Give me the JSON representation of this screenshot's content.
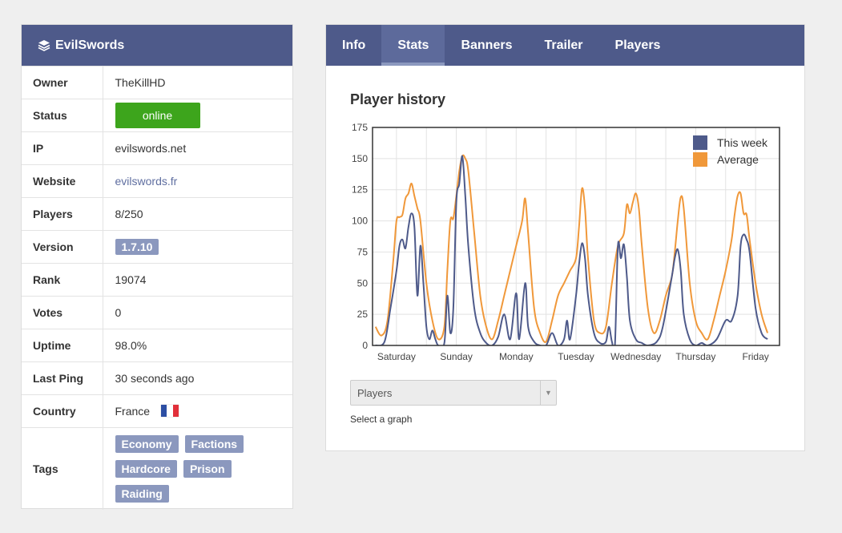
{
  "server": {
    "name": "EvilSwords",
    "icon": "layers-icon",
    "rows": {
      "owner": {
        "label": "Owner",
        "value": "TheKillHD"
      },
      "status": {
        "label": "Status",
        "value": "online",
        "color": "#3da51c"
      },
      "ip": {
        "label": "IP",
        "value": "evilswords.net"
      },
      "website": {
        "label": "Website",
        "value": "evilswords.fr"
      },
      "players": {
        "label": "Players",
        "value": "8/250"
      },
      "version": {
        "label": "Version",
        "value": "1.7.10"
      },
      "rank": {
        "label": "Rank",
        "value": "19074"
      },
      "votes": {
        "label": "Votes",
        "value": "0"
      },
      "uptime": {
        "label": "Uptime",
        "value": "98.0%"
      },
      "last_ping": {
        "label": "Last Ping",
        "value": "30 seconds ago"
      },
      "country": {
        "label": "Country",
        "value": "France",
        "icon": "flag-france-icon"
      },
      "tags": {
        "label": "Tags",
        "items": [
          "Economy",
          "Factions",
          "Hardcore",
          "Prison",
          "Raiding"
        ]
      }
    }
  },
  "tabs": [
    {
      "label": "Info",
      "active": false
    },
    {
      "label": "Stats",
      "active": true
    },
    {
      "label": "Banners",
      "active": false
    },
    {
      "label": "Trailer",
      "active": false
    },
    {
      "label": "Players",
      "active": false
    }
  ],
  "chart": {
    "title": "Player history",
    "select_value": "Players",
    "select_hint": "Select a graph"
  },
  "colors": {
    "header": "#4e5a8a",
    "this_week": "#4e5a8a",
    "average": "#f0983a",
    "tag": "#8b98be"
  },
  "chart_data": {
    "type": "line",
    "title": "Player history",
    "xlabel": "",
    "ylabel": "",
    "x": [
      "Saturday",
      "Sunday",
      "Monday",
      "Tuesday",
      "Wednesday",
      "Thursday",
      "Friday"
    ],
    "ylim": [
      0,
      175
    ],
    "yticks": [
      0,
      25,
      50,
      75,
      100,
      125,
      150,
      175
    ],
    "grid": true,
    "legend": "top-right",
    "series": [
      {
        "name": "This week",
        "color": "#4e5a8a",
        "points": [
          [
            -0.35,
            0
          ],
          [
            -0.2,
            3
          ],
          [
            -0.1,
            30
          ],
          [
            0,
            60
          ],
          [
            0.05,
            80
          ],
          [
            0.1,
            85
          ],
          [
            0.15,
            78
          ],
          [
            0.2,
            95
          ],
          [
            0.25,
            106
          ],
          [
            0.3,
            95
          ],
          [
            0.35,
            40
          ],
          [
            0.4,
            80
          ],
          [
            0.45,
            50
          ],
          [
            0.5,
            15
          ],
          [
            0.55,
            5
          ],
          [
            0.6,
            12
          ],
          [
            0.65,
            5
          ],
          [
            0.7,
            0
          ],
          [
            0.8,
            2
          ],
          [
            0.85,
            40
          ],
          [
            0.9,
            10
          ],
          [
            0.95,
            30
          ],
          [
            1.0,
            115
          ],
          [
            1.05,
            130
          ],
          [
            1.1,
            152
          ],
          [
            1.15,
            120
          ],
          [
            1.2,
            80
          ],
          [
            1.3,
            30
          ],
          [
            1.4,
            10
          ],
          [
            1.5,
            2
          ],
          [
            1.6,
            0
          ],
          [
            1.7,
            7
          ],
          [
            1.8,
            25
          ],
          [
            1.9,
            5
          ],
          [
            2.0,
            42
          ],
          [
            2.05,
            5
          ],
          [
            2.15,
            50
          ],
          [
            2.2,
            15
          ],
          [
            2.3,
            3
          ],
          [
            2.4,
            0
          ],
          [
            2.5,
            0
          ],
          [
            2.6,
            10
          ],
          [
            2.7,
            0
          ],
          [
            2.8,
            5
          ],
          [
            2.85,
            20
          ],
          [
            2.9,
            5
          ],
          [
            3.0,
            40
          ],
          [
            3.05,
            65
          ],
          [
            3.1,
            82
          ],
          [
            3.15,
            70
          ],
          [
            3.2,
            40
          ],
          [
            3.3,
            10
          ],
          [
            3.4,
            2
          ],
          [
            3.5,
            3
          ],
          [
            3.55,
            15
          ],
          [
            3.6,
            3
          ],
          [
            3.65,
            0
          ],
          [
            3.7,
            80
          ],
          [
            3.75,
            70
          ],
          [
            3.8,
            81
          ],
          [
            3.85,
            55
          ],
          [
            3.9,
            20
          ],
          [
            4.0,
            5
          ],
          [
            4.1,
            2
          ],
          [
            4.2,
            0
          ],
          [
            4.35,
            3
          ],
          [
            4.45,
            15
          ],
          [
            4.6,
            55
          ],
          [
            4.65,
            70
          ],
          [
            4.7,
            77
          ],
          [
            4.75,
            60
          ],
          [
            4.8,
            25
          ],
          [
            4.9,
            5
          ],
          [
            5.0,
            0
          ],
          [
            5.1,
            2
          ],
          [
            5.2,
            0
          ],
          [
            5.35,
            5
          ],
          [
            5.5,
            20
          ],
          [
            5.6,
            20
          ],
          [
            5.7,
            40
          ],
          [
            5.75,
            80
          ],
          [
            5.8,
            89
          ],
          [
            5.85,
            85
          ],
          [
            5.9,
            75
          ],
          [
            6.0,
            30
          ],
          [
            6.1,
            10
          ],
          [
            6.2,
            5
          ]
        ]
      },
      {
        "name": "Average",
        "color": "#f0983a",
        "points": [
          [
            -0.35,
            15
          ],
          [
            -0.25,
            8
          ],
          [
            -0.15,
            20
          ],
          [
            -0.05,
            70
          ],
          [
            0,
            100
          ],
          [
            0.05,
            103
          ],
          [
            0.1,
            105
          ],
          [
            0.15,
            118
          ],
          [
            0.2,
            122
          ],
          [
            0.25,
            130
          ],
          [
            0.3,
            120
          ],
          [
            0.35,
            110
          ],
          [
            0.4,
            100
          ],
          [
            0.5,
            50
          ],
          [
            0.6,
            20
          ],
          [
            0.7,
            5
          ],
          [
            0.8,
            15
          ],
          [
            0.85,
            60
          ],
          [
            0.9,
            100
          ],
          [
            0.95,
            102
          ],
          [
            1.0,
            120
          ],
          [
            1.05,
            140
          ],
          [
            1.1,
            152
          ],
          [
            1.15,
            150
          ],
          [
            1.2,
            140
          ],
          [
            1.3,
            90
          ],
          [
            1.4,
            40
          ],
          [
            1.5,
            15
          ],
          [
            1.6,
            5
          ],
          [
            1.7,
            20
          ],
          [
            1.8,
            40
          ],
          [
            1.9,
            60
          ],
          [
            2.0,
            80
          ],
          [
            2.1,
            100
          ],
          [
            2.15,
            118
          ],
          [
            2.2,
            90
          ],
          [
            2.3,
            30
          ],
          [
            2.4,
            10
          ],
          [
            2.5,
            3
          ],
          [
            2.6,
            20
          ],
          [
            2.7,
            40
          ],
          [
            2.8,
            50
          ],
          [
            2.9,
            60
          ],
          [
            3.0,
            70
          ],
          [
            3.05,
            95
          ],
          [
            3.1,
            126
          ],
          [
            3.15,
            110
          ],
          [
            3.2,
            70
          ],
          [
            3.3,
            20
          ],
          [
            3.4,
            10
          ],
          [
            3.5,
            15
          ],
          [
            3.6,
            50
          ],
          [
            3.7,
            80
          ],
          [
            3.8,
            90
          ],
          [
            3.85,
            113
          ],
          [
            3.9,
            106
          ],
          [
            3.95,
            115
          ],
          [
            4.0,
            122
          ],
          [
            4.05,
            110
          ],
          [
            4.1,
            80
          ],
          [
            4.2,
            30
          ],
          [
            4.3,
            10
          ],
          [
            4.4,
            20
          ],
          [
            4.5,
            40
          ],
          [
            4.6,
            55
          ],
          [
            4.65,
            75
          ],
          [
            4.7,
            100
          ],
          [
            4.75,
            119
          ],
          [
            4.8,
            110
          ],
          [
            4.9,
            50
          ],
          [
            5.0,
            20
          ],
          [
            5.1,
            10
          ],
          [
            5.2,
            5
          ],
          [
            5.3,
            20
          ],
          [
            5.4,
            40
          ],
          [
            5.5,
            60
          ],
          [
            5.6,
            85
          ],
          [
            5.65,
            105
          ],
          [
            5.7,
            120
          ],
          [
            5.75,
            122
          ],
          [
            5.8,
            106
          ],
          [
            5.85,
            105
          ],
          [
            5.9,
            85
          ],
          [
            6.0,
            50
          ],
          [
            6.1,
            25
          ],
          [
            6.2,
            10
          ]
        ]
      }
    ]
  }
}
